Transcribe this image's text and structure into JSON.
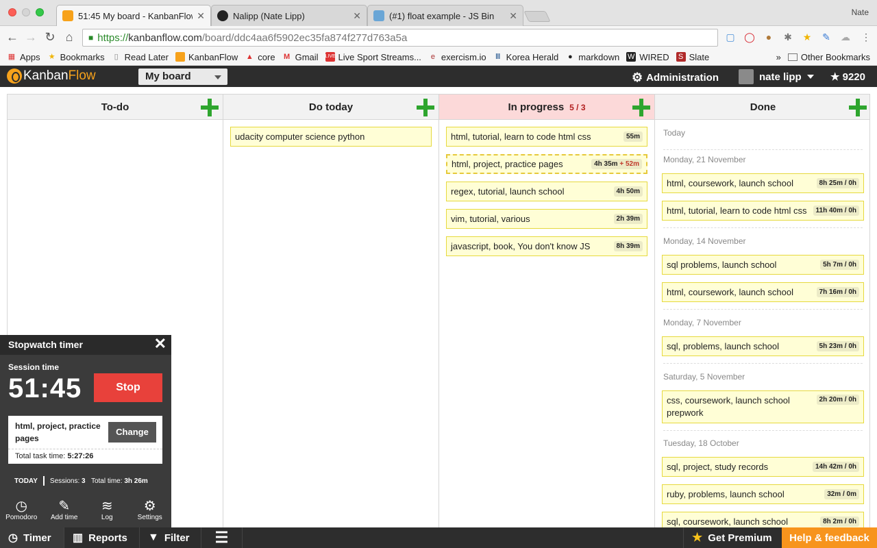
{
  "browser": {
    "tabs": [
      {
        "title": "51:45 My board - KanbanFlow",
        "active": true
      },
      {
        "title": "Nalipp (Nate Lipp)",
        "active": false
      },
      {
        "title": "(#1) float example - JS Bin",
        "active": false
      }
    ],
    "profile_name": "Nate",
    "url_scheme": "https://",
    "url_domain": "kanbanflow.com",
    "url_path": "/board/ddc4aa6f5902ec35fa874f277d763a5a",
    "bookmarks": [
      "Apps",
      "Bookmarks",
      "Read Later",
      "KanbanFlow",
      "core",
      "Gmail",
      "Live Sport Streams...",
      "exercism.io",
      "Korea Herald",
      "markdown",
      "WIRED",
      "Slate"
    ],
    "bookmarks_more": "»",
    "other_bookmarks": "Other Bookmarks"
  },
  "app": {
    "logo_left": "Kanban",
    "logo_right": "Flow",
    "board_name": "My board",
    "admin_label": "Administration",
    "user_name": "nate lipp",
    "points": "9220",
    "colors": {
      "accent": "#f7a21b",
      "add": "#2ea52e",
      "stop": "#e8413b",
      "wip": "#b21f1f"
    }
  },
  "columns": [
    {
      "title": "To-do",
      "wip": "",
      "tasks": []
    },
    {
      "title": "Do today",
      "wip": "",
      "tasks": [
        {
          "name": "udacity computer science python",
          "time": ""
        }
      ]
    },
    {
      "title": "In progress",
      "wip": "5 / 3",
      "tasks": [
        {
          "name": "html, tutorial, learn to code html css",
          "time": "55m"
        },
        {
          "name": "html, project, practice pages",
          "time": "4h 35m",
          "extra": "+ 52m"
        },
        {
          "name": "regex, tutorial, launch school",
          "time": "4h 50m"
        },
        {
          "name": "vim, tutorial, various",
          "time": "2h 39m"
        },
        {
          "name": "javascript, book, You don't know JS",
          "time": "8h 39m"
        }
      ]
    },
    {
      "title": "Done",
      "wip": "",
      "groups": [
        {
          "label": "Today",
          "tasks": []
        },
        {
          "label": "Monday, 21 November",
          "tasks": [
            {
              "name": "html, coursework, launch school",
              "time": "8h 25m / 0h"
            },
            {
              "name": "html, tutorial, learn to code html css",
              "time": "11h 40m / 0h"
            }
          ]
        },
        {
          "label": "Monday, 14 November",
          "tasks": [
            {
              "name": "sql problems, launch school",
              "time": "5h 7m / 0h"
            },
            {
              "name": "html, coursework, launch school",
              "time": "7h 16m / 0h"
            }
          ]
        },
        {
          "label": "Monday, 7 November",
          "tasks": [
            {
              "name": "sql, problems, launch school",
              "time": "5h 23m / 0h"
            }
          ]
        },
        {
          "label": "Saturday, 5 November",
          "tasks": [
            {
              "name": "css, coursework, launch school prepwork",
              "time": "2h 20m / 0h"
            }
          ]
        },
        {
          "label": "Tuesday, 18 October",
          "tasks": [
            {
              "name": "sql, project, study records",
              "time": "14h 42m / 0h"
            },
            {
              "name": "ruby, problems, launch school",
              "time": "32m / 0m"
            },
            {
              "name": "sql, coursework, launch school",
              "time": "8h 2m / 0h"
            }
          ]
        }
      ]
    }
  ],
  "timer": {
    "title": "Stopwatch timer",
    "session_label": "Session time",
    "session_time": "51:45",
    "stop_label": "Stop",
    "task_name": "html, project, practice pages",
    "change_label": "Change",
    "total_task_label": "Total task time:",
    "total_task_time": "5:27:26",
    "today_label": "TODAY",
    "sessions_label": "Sessions:",
    "sessions_count": "3",
    "total_time_label": "Total time:",
    "total_time": "3h 26m",
    "tools": [
      {
        "label": "Pomodoro",
        "icon": "tomato-icon"
      },
      {
        "label": "Add time",
        "icon": "edit-icon"
      },
      {
        "label": "Log",
        "icon": "layers-icon"
      },
      {
        "label": "Settings",
        "icon": "gear-icon"
      }
    ]
  },
  "bottom_bar": {
    "timer_label": "Timer",
    "reports_label": "Reports",
    "filter_label": "Filter",
    "premium_label": "Get Premium",
    "help_label": "Help & feedback"
  }
}
